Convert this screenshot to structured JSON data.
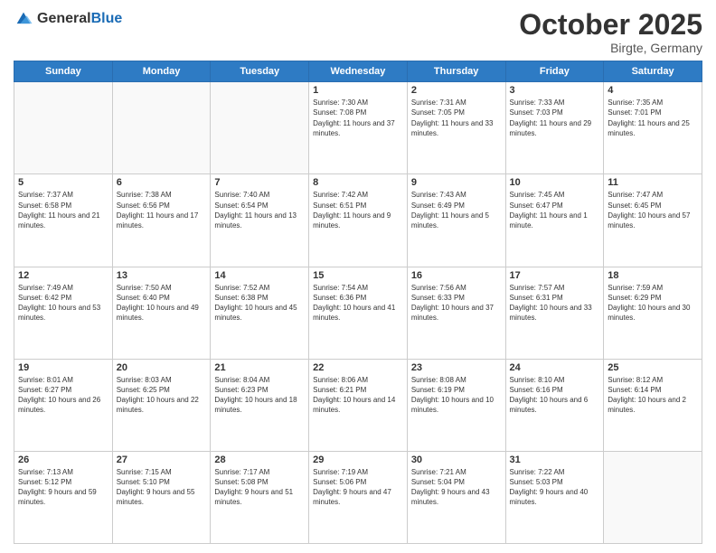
{
  "header": {
    "logo_general": "General",
    "logo_blue": "Blue",
    "month_title": "October 2025",
    "location": "Birgte, Germany"
  },
  "weekdays": [
    "Sunday",
    "Monday",
    "Tuesday",
    "Wednesday",
    "Thursday",
    "Friday",
    "Saturday"
  ],
  "weeks": [
    [
      {
        "day": "",
        "sunrise": "",
        "sunset": "",
        "daylight": ""
      },
      {
        "day": "",
        "sunrise": "",
        "sunset": "",
        "daylight": ""
      },
      {
        "day": "",
        "sunrise": "",
        "sunset": "",
        "daylight": ""
      },
      {
        "day": "1",
        "sunrise": "Sunrise: 7:30 AM",
        "sunset": "Sunset: 7:08 PM",
        "daylight": "Daylight: 11 hours and 37 minutes."
      },
      {
        "day": "2",
        "sunrise": "Sunrise: 7:31 AM",
        "sunset": "Sunset: 7:05 PM",
        "daylight": "Daylight: 11 hours and 33 minutes."
      },
      {
        "day": "3",
        "sunrise": "Sunrise: 7:33 AM",
        "sunset": "Sunset: 7:03 PM",
        "daylight": "Daylight: 11 hours and 29 minutes."
      },
      {
        "day": "4",
        "sunrise": "Sunrise: 7:35 AM",
        "sunset": "Sunset: 7:01 PM",
        "daylight": "Daylight: 11 hours and 25 minutes."
      }
    ],
    [
      {
        "day": "5",
        "sunrise": "Sunrise: 7:37 AM",
        "sunset": "Sunset: 6:58 PM",
        "daylight": "Daylight: 11 hours and 21 minutes."
      },
      {
        "day": "6",
        "sunrise": "Sunrise: 7:38 AM",
        "sunset": "Sunset: 6:56 PM",
        "daylight": "Daylight: 11 hours and 17 minutes."
      },
      {
        "day": "7",
        "sunrise": "Sunrise: 7:40 AM",
        "sunset": "Sunset: 6:54 PM",
        "daylight": "Daylight: 11 hours and 13 minutes."
      },
      {
        "day": "8",
        "sunrise": "Sunrise: 7:42 AM",
        "sunset": "Sunset: 6:51 PM",
        "daylight": "Daylight: 11 hours and 9 minutes."
      },
      {
        "day": "9",
        "sunrise": "Sunrise: 7:43 AM",
        "sunset": "Sunset: 6:49 PM",
        "daylight": "Daylight: 11 hours and 5 minutes."
      },
      {
        "day": "10",
        "sunrise": "Sunrise: 7:45 AM",
        "sunset": "Sunset: 6:47 PM",
        "daylight": "Daylight: 11 hours and 1 minute."
      },
      {
        "day": "11",
        "sunrise": "Sunrise: 7:47 AM",
        "sunset": "Sunset: 6:45 PM",
        "daylight": "Daylight: 10 hours and 57 minutes."
      }
    ],
    [
      {
        "day": "12",
        "sunrise": "Sunrise: 7:49 AM",
        "sunset": "Sunset: 6:42 PM",
        "daylight": "Daylight: 10 hours and 53 minutes."
      },
      {
        "day": "13",
        "sunrise": "Sunrise: 7:50 AM",
        "sunset": "Sunset: 6:40 PM",
        "daylight": "Daylight: 10 hours and 49 minutes."
      },
      {
        "day": "14",
        "sunrise": "Sunrise: 7:52 AM",
        "sunset": "Sunset: 6:38 PM",
        "daylight": "Daylight: 10 hours and 45 minutes."
      },
      {
        "day": "15",
        "sunrise": "Sunrise: 7:54 AM",
        "sunset": "Sunset: 6:36 PM",
        "daylight": "Daylight: 10 hours and 41 minutes."
      },
      {
        "day": "16",
        "sunrise": "Sunrise: 7:56 AM",
        "sunset": "Sunset: 6:33 PM",
        "daylight": "Daylight: 10 hours and 37 minutes."
      },
      {
        "day": "17",
        "sunrise": "Sunrise: 7:57 AM",
        "sunset": "Sunset: 6:31 PM",
        "daylight": "Daylight: 10 hours and 33 minutes."
      },
      {
        "day": "18",
        "sunrise": "Sunrise: 7:59 AM",
        "sunset": "Sunset: 6:29 PM",
        "daylight": "Daylight: 10 hours and 30 minutes."
      }
    ],
    [
      {
        "day": "19",
        "sunrise": "Sunrise: 8:01 AM",
        "sunset": "Sunset: 6:27 PM",
        "daylight": "Daylight: 10 hours and 26 minutes."
      },
      {
        "day": "20",
        "sunrise": "Sunrise: 8:03 AM",
        "sunset": "Sunset: 6:25 PM",
        "daylight": "Daylight: 10 hours and 22 minutes."
      },
      {
        "day": "21",
        "sunrise": "Sunrise: 8:04 AM",
        "sunset": "Sunset: 6:23 PM",
        "daylight": "Daylight: 10 hours and 18 minutes."
      },
      {
        "day": "22",
        "sunrise": "Sunrise: 8:06 AM",
        "sunset": "Sunset: 6:21 PM",
        "daylight": "Daylight: 10 hours and 14 minutes."
      },
      {
        "day": "23",
        "sunrise": "Sunrise: 8:08 AM",
        "sunset": "Sunset: 6:19 PM",
        "daylight": "Daylight: 10 hours and 10 minutes."
      },
      {
        "day": "24",
        "sunrise": "Sunrise: 8:10 AM",
        "sunset": "Sunset: 6:16 PM",
        "daylight": "Daylight: 10 hours and 6 minutes."
      },
      {
        "day": "25",
        "sunrise": "Sunrise: 8:12 AM",
        "sunset": "Sunset: 6:14 PM",
        "daylight": "Daylight: 10 hours and 2 minutes."
      }
    ],
    [
      {
        "day": "26",
        "sunrise": "Sunrise: 7:13 AM",
        "sunset": "Sunset: 5:12 PM",
        "daylight": "Daylight: 9 hours and 59 minutes."
      },
      {
        "day": "27",
        "sunrise": "Sunrise: 7:15 AM",
        "sunset": "Sunset: 5:10 PM",
        "daylight": "Daylight: 9 hours and 55 minutes."
      },
      {
        "day": "28",
        "sunrise": "Sunrise: 7:17 AM",
        "sunset": "Sunset: 5:08 PM",
        "daylight": "Daylight: 9 hours and 51 minutes."
      },
      {
        "day": "29",
        "sunrise": "Sunrise: 7:19 AM",
        "sunset": "Sunset: 5:06 PM",
        "daylight": "Daylight: 9 hours and 47 minutes."
      },
      {
        "day": "30",
        "sunrise": "Sunrise: 7:21 AM",
        "sunset": "Sunset: 5:04 PM",
        "daylight": "Daylight: 9 hours and 43 minutes."
      },
      {
        "day": "31",
        "sunrise": "Sunrise: 7:22 AM",
        "sunset": "Sunset: 5:03 PM",
        "daylight": "Daylight: 9 hours and 40 minutes."
      },
      {
        "day": "",
        "sunrise": "",
        "sunset": "",
        "daylight": ""
      }
    ]
  ]
}
